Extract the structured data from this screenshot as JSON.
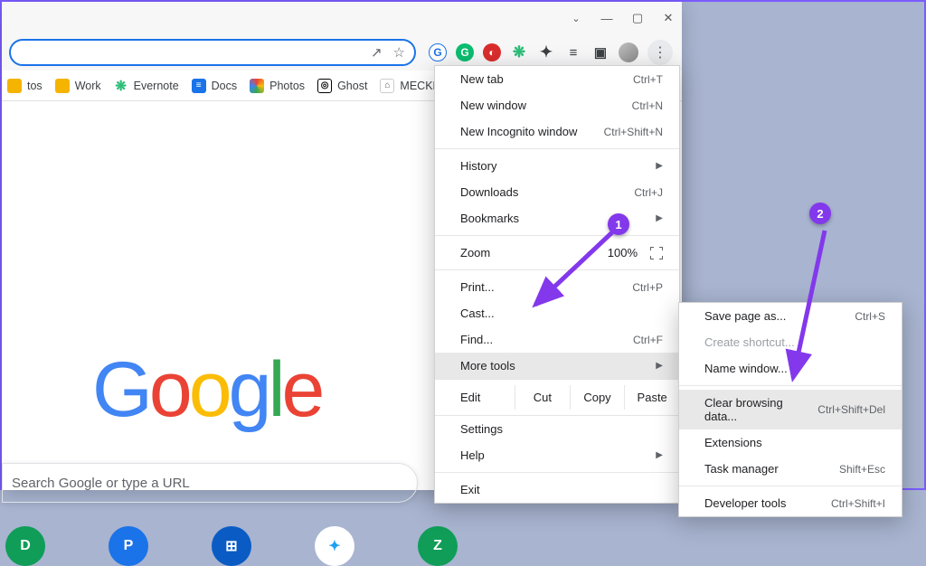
{
  "window_controls": {
    "chevron": "⌄",
    "min": "—",
    "max": "▢",
    "close": "✕"
  },
  "omnibox": {
    "share_icon": "↗",
    "star_icon": "☆"
  },
  "extensions": [
    {
      "bg": "#1a73e8",
      "glyph": "G",
      "shape": "circle"
    },
    {
      "bg": "#0bbd6f",
      "glyph": "G",
      "shape": "circle"
    },
    {
      "bg": "#d92d2d",
      "glyph": "◐",
      "shape": "circle"
    },
    {
      "bg": "#2dbd78",
      "glyph": "❋",
      "shape": "none"
    },
    {
      "bg": "#3c4043",
      "glyph": "✦",
      "shape": "none"
    },
    {
      "bg": "#3c4043",
      "glyph": "≡",
      "shape": "none"
    },
    {
      "bg": "#3c4043",
      "glyph": "▣",
      "shape": "none"
    }
  ],
  "kebab_glyph": "⋮",
  "bookmarks": [
    {
      "label": "tos",
      "icon_bg": "#f4b400",
      "glyph": ""
    },
    {
      "label": "Work",
      "icon_bg": "#f4b400",
      "glyph": ""
    },
    {
      "label": "Evernote",
      "icon_bg": "#2dbd78",
      "glyph": "❋"
    },
    {
      "label": "Docs",
      "icon_bg": "#1a73e8",
      "glyph": "≡"
    },
    {
      "label": "Photos",
      "icon_bg": "linear",
      "glyph": "✦"
    },
    {
      "label": "Ghost",
      "icon_bg": "#000",
      "glyph": "◎"
    },
    {
      "label": "MECKEYS",
      "icon_bg": "#888",
      "glyph": "⌂"
    }
  ],
  "logo_letters": [
    "G",
    "o",
    "o",
    "g",
    "l",
    "e"
  ],
  "search_placeholder": "Search Google or type a URL",
  "tiles": [
    {
      "bg": "#0f9d58",
      "glyph": "D"
    },
    {
      "bg": "#1a73e8",
      "glyph": "P"
    },
    {
      "bg": "#0a5cc4",
      "glyph": "⊞"
    },
    {
      "bg": "#1da1f2",
      "glyph": "✦"
    },
    {
      "bg": "#0f9d58",
      "glyph": "Z"
    }
  ],
  "menu": {
    "new_tab": {
      "label": "New tab",
      "shortcut": "Ctrl+T"
    },
    "new_window": {
      "label": "New window",
      "shortcut": "Ctrl+N"
    },
    "new_incognito": {
      "label": "New Incognito window",
      "shortcut": "Ctrl+Shift+N"
    },
    "history": {
      "label": "History"
    },
    "downloads": {
      "label": "Downloads",
      "shortcut": "Ctrl+J"
    },
    "bookmarks": {
      "label": "Bookmarks"
    },
    "zoom": {
      "label": "Zoom",
      "minus": "−",
      "value": "100%",
      "plus": "+"
    },
    "print": {
      "label": "Print...",
      "shortcut": "Ctrl+P"
    },
    "cast": {
      "label": "Cast..."
    },
    "find": {
      "label": "Find...",
      "shortcut": "Ctrl+F"
    },
    "more_tools": {
      "label": "More tools"
    },
    "edit": {
      "label": "Edit",
      "cut": "Cut",
      "copy": "Copy",
      "paste": "Paste"
    },
    "settings": {
      "label": "Settings"
    },
    "help": {
      "label": "Help"
    },
    "exit": {
      "label": "Exit"
    }
  },
  "submenu": {
    "save_page": {
      "label": "Save page as...",
      "shortcut": "Ctrl+S"
    },
    "create_shortcut": {
      "label": "Create shortcut..."
    },
    "name_window": {
      "label": "Name window..."
    },
    "clear_data": {
      "label": "Clear browsing data...",
      "shortcut": "Ctrl+Shift+Del"
    },
    "extensions": {
      "label": "Extensions"
    },
    "task_manager": {
      "label": "Task manager",
      "shortcut": "Shift+Esc"
    },
    "dev_tools": {
      "label": "Developer tools",
      "shortcut": "Ctrl+Shift+I"
    }
  },
  "annotations": {
    "one": "1",
    "two": "2"
  }
}
